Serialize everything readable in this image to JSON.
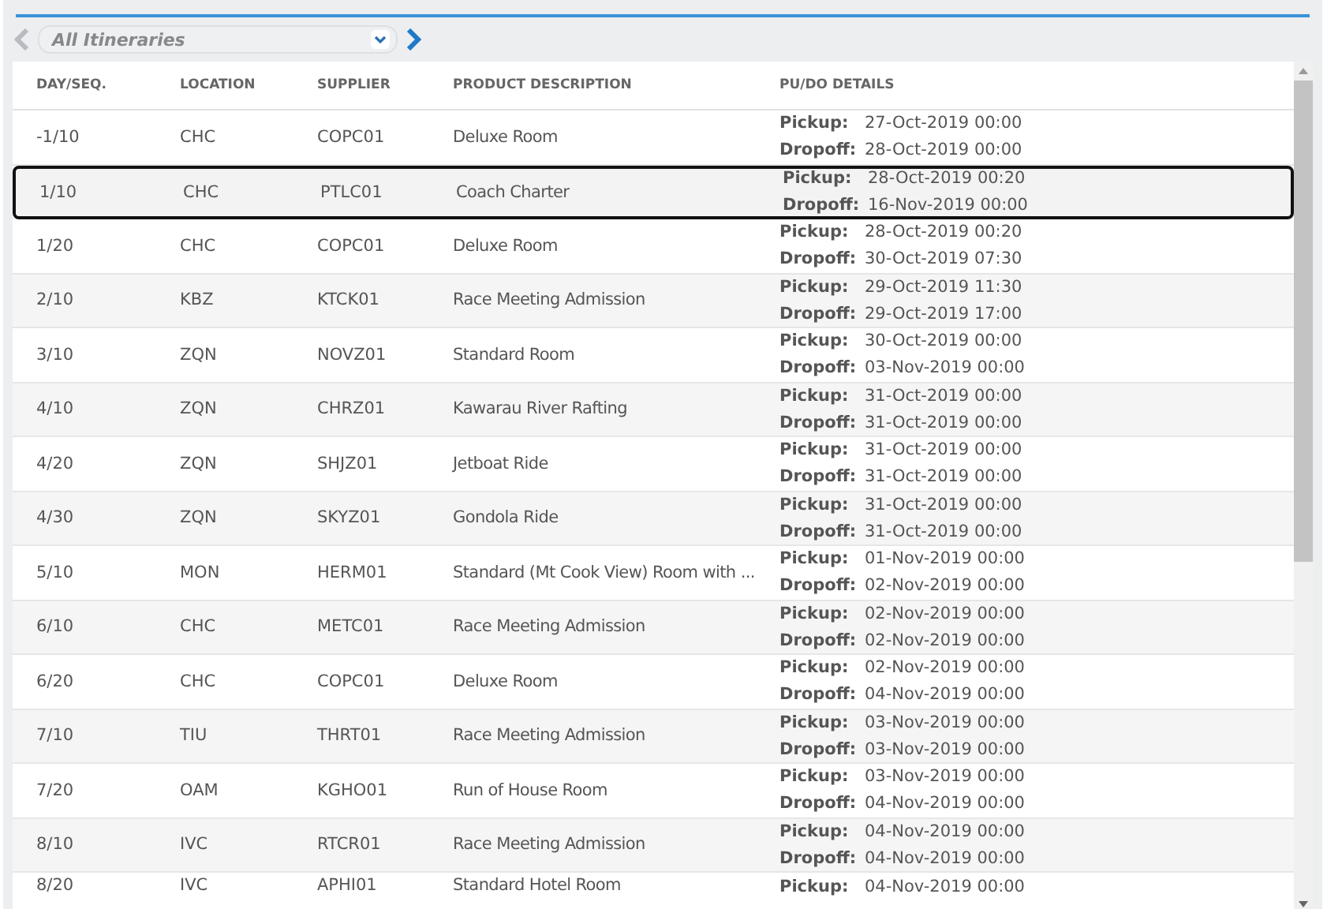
{
  "toolbar": {
    "prev": {
      "disabled": true
    },
    "next": {
      "disabled": false
    },
    "filter": {
      "value": "All Itineraries"
    }
  },
  "table": {
    "columns": [
      "DAY/SEQ.",
      "LOCATION",
      "SUPPLIER",
      "PRODUCT DESCRIPTION",
      "PU/DO DETAILS"
    ],
    "rows": [
      {
        "day": "-1/10",
        "location": "CHC",
        "supplier": "COPC01",
        "description": "Deluxe Room",
        "details": [
          {
            "label": "Pickup:",
            "value": "27-Oct-2019 00:00"
          },
          {
            "label": "Dropoff:",
            "value": "28-Oct-2019 00:00"
          }
        ],
        "selected": false
      },
      {
        "day": "1/10",
        "location": "CHC",
        "supplier": "PTLC01",
        "description": "Coach Charter",
        "details": [
          {
            "label": "Pickup:",
            "value": "28-Oct-2019 00:20"
          },
          {
            "label": "Dropoff:",
            "value": "16-Nov-2019 00:00"
          }
        ],
        "selected": true
      },
      {
        "day": "1/20",
        "location": "CHC",
        "supplier": "COPC01",
        "description": "Deluxe Room",
        "details": [
          {
            "label": "Pickup:",
            "value": "28-Oct-2019 00:20"
          },
          {
            "label": "Dropoff:",
            "value": "30-Oct-2019 07:30"
          }
        ],
        "selected": false
      },
      {
        "day": "2/10",
        "location": "KBZ",
        "supplier": "KTCK01",
        "description": "Race Meeting Admission",
        "details": [
          {
            "label": "Pickup:",
            "value": "29-Oct-2019 11:30"
          },
          {
            "label": "Dropoff:",
            "value": "29-Oct-2019 17:00"
          }
        ],
        "selected": false
      },
      {
        "day": "3/10",
        "location": "ZQN",
        "supplier": "NOVZ01",
        "description": "Standard Room",
        "details": [
          {
            "label": "Pickup:",
            "value": "30-Oct-2019 00:00"
          },
          {
            "label": "Dropoff:",
            "value": "03-Nov-2019 00:00"
          }
        ],
        "selected": false
      },
      {
        "day": "4/10",
        "location": "ZQN",
        "supplier": "CHRZ01",
        "description": "Kawarau River Rafting",
        "details": [
          {
            "label": "Pickup:",
            "value": "31-Oct-2019 00:00"
          },
          {
            "label": "Dropoff:",
            "value": "31-Oct-2019 00:00"
          }
        ],
        "selected": false
      },
      {
        "day": "4/20",
        "location": "ZQN",
        "supplier": "SHJZ01",
        "description": "Jetboat Ride",
        "details": [
          {
            "label": "Pickup:",
            "value": "31-Oct-2019 00:00"
          },
          {
            "label": "Dropoff:",
            "value": "31-Oct-2019 00:00"
          }
        ],
        "selected": false
      },
      {
        "day": "4/30",
        "location": "ZQN",
        "supplier": "SKYZ01",
        "description": "Gondola Ride",
        "details": [
          {
            "label": "Pickup:",
            "value": "31-Oct-2019 00:00"
          },
          {
            "label": "Dropoff:",
            "value": "31-Oct-2019 00:00"
          }
        ],
        "selected": false
      },
      {
        "day": "5/10",
        "location": "MON",
        "supplier": "HERM01",
        "description": "Standard (Mt Cook View) Room with ...",
        "details": [
          {
            "label": "Pickup:",
            "value": "01-Nov-2019 00:00"
          },
          {
            "label": "Dropoff:",
            "value": "02-Nov-2019 00:00"
          }
        ],
        "selected": false
      },
      {
        "day": "6/10",
        "location": "CHC",
        "supplier": "METC01",
        "description": "Race Meeting Admission",
        "details": [
          {
            "label": "Pickup:",
            "value": "02-Nov-2019 00:00"
          },
          {
            "label": "Dropoff:",
            "value": "02-Nov-2019 00:00"
          }
        ],
        "selected": false
      },
      {
        "day": "6/20",
        "location": "CHC",
        "supplier": "COPC01",
        "description": "Deluxe Room",
        "details": [
          {
            "label": "Pickup:",
            "value": "02-Nov-2019 00:00"
          },
          {
            "label": "Dropoff:",
            "value": "04-Nov-2019 00:00"
          }
        ],
        "selected": false
      },
      {
        "day": "7/10",
        "location": "TIU",
        "supplier": "THRT01",
        "description": "Race Meeting Admission",
        "details": [
          {
            "label": "Pickup:",
            "value": "03-Nov-2019 00:00"
          },
          {
            "label": "Dropoff:",
            "value": "03-Nov-2019 00:00"
          }
        ],
        "selected": false
      },
      {
        "day": "7/20",
        "location": "OAM",
        "supplier": "KGHO01",
        "description": "Run of House Room",
        "details": [
          {
            "label": "Pickup:",
            "value": "03-Nov-2019 00:00"
          },
          {
            "label": "Dropoff:",
            "value": "04-Nov-2019 00:00"
          }
        ],
        "selected": false
      },
      {
        "day": "8/10",
        "location": "IVC",
        "supplier": "RTCR01",
        "description": "Race Meeting Admission",
        "details": [
          {
            "label": "Pickup:",
            "value": "04-Nov-2019 00:00"
          },
          {
            "label": "Dropoff:",
            "value": "04-Nov-2019 00:00"
          }
        ],
        "selected": false
      },
      {
        "day": "8/20",
        "location": "IVC",
        "supplier": "APHI01",
        "description": "Standard Hotel Room",
        "details": [
          {
            "label": "Pickup:",
            "value": "04-Nov-2019 00:00"
          }
        ],
        "selected": false
      }
    ]
  }
}
